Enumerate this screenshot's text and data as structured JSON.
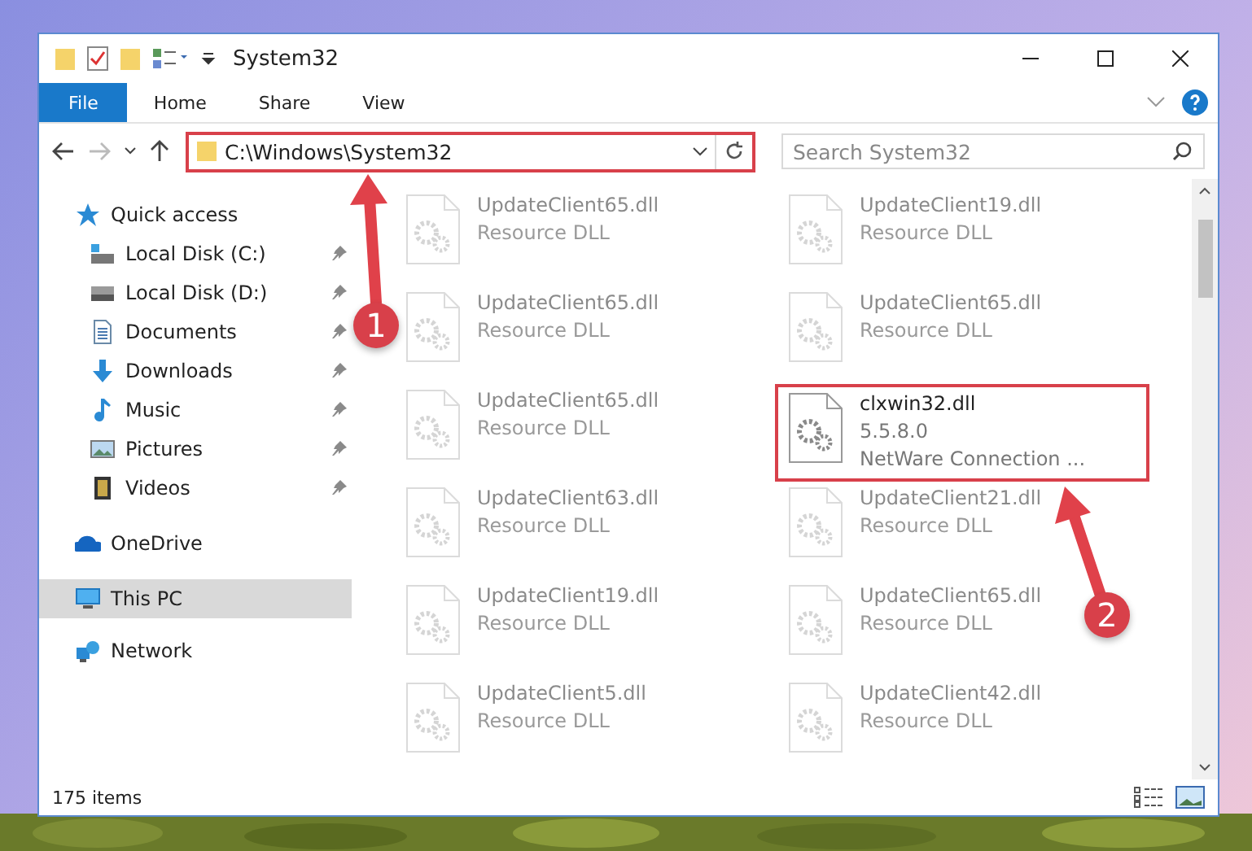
{
  "window": {
    "title": "System32"
  },
  "ribbon": {
    "tabs": [
      {
        "label": "File",
        "selected": true
      },
      {
        "label": "Home",
        "selected": false
      },
      {
        "label": "Share",
        "selected": false
      },
      {
        "label": "View",
        "selected": false
      }
    ]
  },
  "address": {
    "path": "C:\\Windows\\System32",
    "search_placeholder": "Search System32"
  },
  "sidebar": {
    "items": [
      {
        "label": "Quick access",
        "selected": false,
        "children": [
          {
            "label": "Local Disk (C:)",
            "pinned": true
          },
          {
            "label": "Local Disk (D:)",
            "pinned": true
          },
          {
            "label": "Documents",
            "pinned": true
          },
          {
            "label": "Downloads",
            "pinned": true
          },
          {
            "label": "Music",
            "pinned": true
          },
          {
            "label": "Pictures",
            "pinned": true
          },
          {
            "label": "Videos",
            "pinned": true
          }
        ]
      },
      {
        "label": "OneDrive",
        "selected": false
      },
      {
        "label": "This PC",
        "selected": true
      },
      {
        "label": "Network",
        "selected": false
      }
    ]
  },
  "files": [
    {
      "kind": "faded",
      "name": "UpdateClient65.dll",
      "type": "Resource DLL"
    },
    {
      "kind": "faded",
      "name": "UpdateClient19.dll",
      "type": "Resource DLL"
    },
    {
      "kind": "faded",
      "name": "UpdateClient65.dll",
      "type": "Resource DLL"
    },
    {
      "kind": "faded",
      "name": "UpdateClient65.dll",
      "type": "Resource DLL"
    },
    {
      "kind": "faded",
      "name": "UpdateClient65.dll",
      "type": "Resource DLL"
    },
    {
      "kind": "highlighted",
      "name": "clxwin32.dll",
      "version": "5.5.8.0",
      "type": "NetWare Connection ..."
    },
    {
      "kind": "faded",
      "name": "UpdateClient63.dll",
      "type": "Resource DLL"
    },
    {
      "kind": "faded",
      "name": "UpdateClient21.dll",
      "type": "Resource DLL"
    },
    {
      "kind": "faded",
      "name": "UpdateClient19.dll",
      "type": "Resource DLL"
    },
    {
      "kind": "faded",
      "name": "UpdateClient65.dll",
      "type": "Resource DLL"
    },
    {
      "kind": "faded",
      "name": "UpdateClient5.dll",
      "type": "Resource DLL"
    },
    {
      "kind": "faded",
      "name": "UpdateClient42.dll",
      "type": "Resource DLL"
    }
  ],
  "status_bar": {
    "count": "175 items"
  },
  "annotations": [
    {
      "number": "1"
    },
    {
      "number": "2"
    }
  ]
}
